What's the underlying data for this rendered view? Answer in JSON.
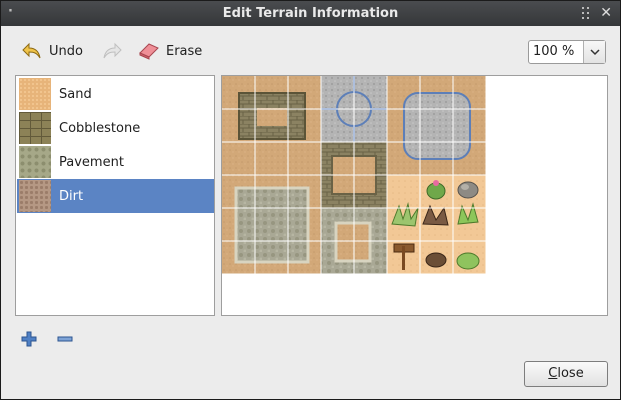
{
  "window": {
    "title": "Edit Terrain Information"
  },
  "toolbar": {
    "undo_label": "Undo",
    "undo_icon": "undo-arrow-icon",
    "redo_icon": "redo-arrow-icon",
    "erase_label": "Erase",
    "erase_icon": "eraser-icon",
    "zoom_value": "100 %"
  },
  "terrains": [
    {
      "label": "Sand",
      "color": "#e7b47a",
      "selected": false
    },
    {
      "label": "Cobblestone",
      "color": "#8c8257",
      "selected": false
    },
    {
      "label": "Pavement",
      "color": "#a6a888",
      "selected": false
    },
    {
      "label": "Dirt",
      "color": "#b59884",
      "selected": true
    }
  ],
  "footer": {
    "add_icon": "add-icon",
    "remove_icon": "remove-icon",
    "close_label": "Close",
    "close_mnemonic": "C",
    "close_rest": "lose"
  },
  "colors": {
    "selection": "#5b84c4",
    "sand": "#d2a878",
    "cobble": "#8b8262",
    "pavement": "#a9a895",
    "blue_outline": "#5d7fb8",
    "light_sand": "#f2c896"
  }
}
